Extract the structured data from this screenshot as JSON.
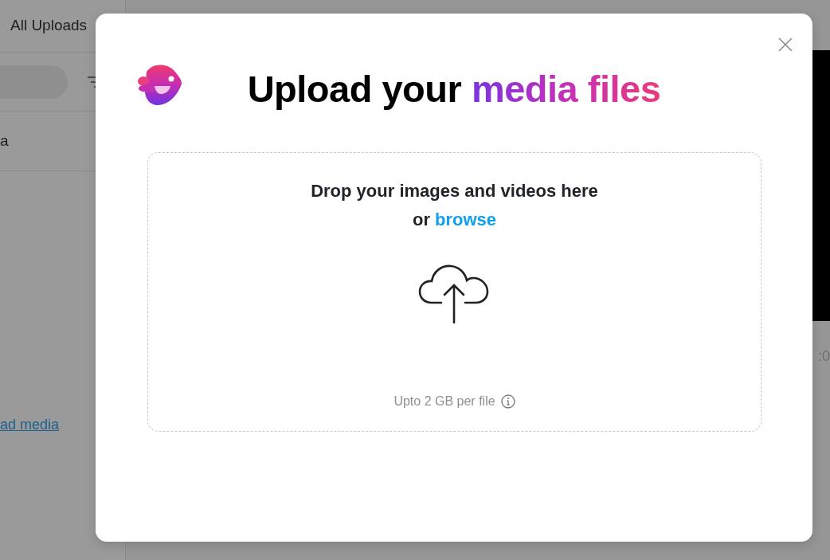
{
  "background": {
    "sidebar": {
      "title": "All Uploads",
      "item": "a",
      "link": "ad media"
    },
    "player": {
      "time": ":0"
    }
  },
  "modal": {
    "title": {
      "lead": "Upload your",
      "highlight": "media files"
    },
    "dropzone": {
      "heading": "Drop your images and videos here",
      "or": "or",
      "browse": "browse",
      "limit": "Upto 2 GB per file"
    }
  }
}
